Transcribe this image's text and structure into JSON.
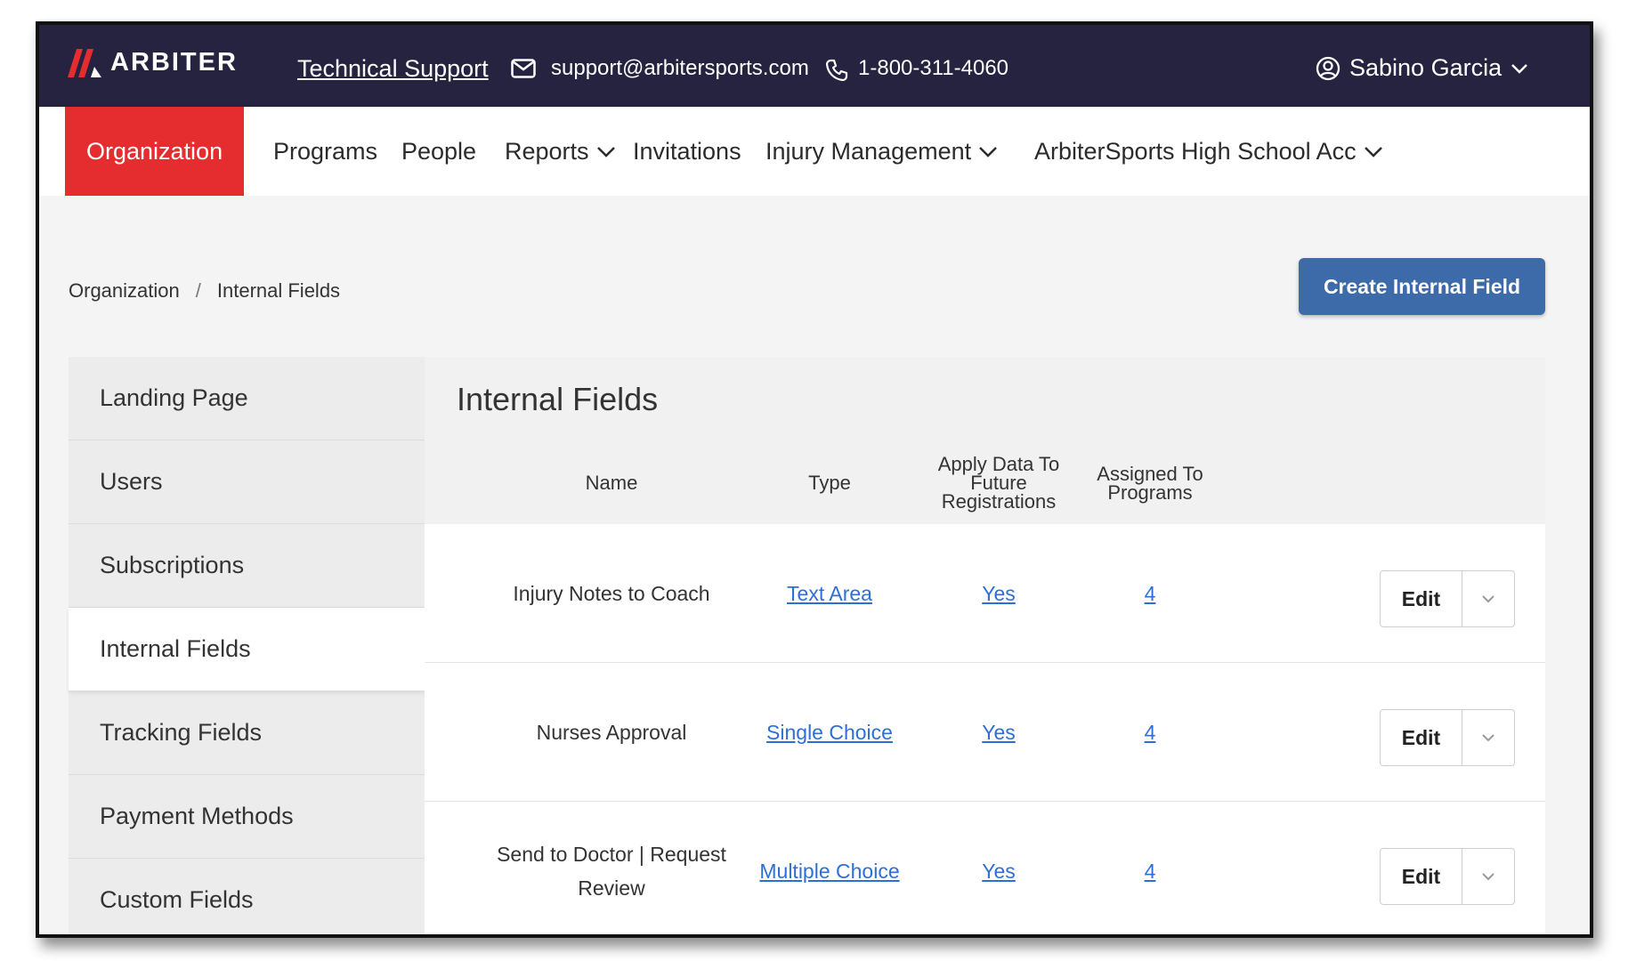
{
  "topbar": {
    "brand": "ARBITER",
    "support_link": "Technical Support",
    "email": "support@arbitersports.com",
    "phone": "1-800-311-4060",
    "user_name": "Sabino Garcia"
  },
  "nav": {
    "items": [
      {
        "label": "Organization",
        "active": true
      },
      {
        "label": "Programs"
      },
      {
        "label": "People"
      },
      {
        "label": "Reports",
        "has_dropdown": true
      },
      {
        "label": "Invitations"
      },
      {
        "label": "Injury Management",
        "has_dropdown": true
      },
      {
        "label": "ArbiterSports High School Acc",
        "has_dropdown": true
      }
    ]
  },
  "breadcrumb": {
    "items": [
      "Organization",
      "Internal Fields"
    ],
    "separator": "/"
  },
  "create_button": "Create Internal Field",
  "sidebar": {
    "items": [
      {
        "label": "Landing Page"
      },
      {
        "label": "Users"
      },
      {
        "label": "Subscriptions"
      },
      {
        "label": "Internal Fields",
        "active": true
      },
      {
        "label": "Tracking Fields"
      },
      {
        "label": "Payment Methods"
      },
      {
        "label": "Custom Fields"
      }
    ]
  },
  "panel": {
    "title": "Internal Fields",
    "columns": [
      "Name",
      "Type",
      "Apply Data To Future Registrations",
      "Assigned To Programs"
    ],
    "rows": [
      {
        "name": "Injury Notes to Coach",
        "type": "Text Area",
        "apply": "Yes",
        "assigned": "4",
        "edit": "Edit"
      },
      {
        "name": "Nurses Approval",
        "type": "Single Choice",
        "apply": "Yes",
        "assigned": "4",
        "edit": "Edit"
      },
      {
        "name": "Send to Doctor | Request Review",
        "type": "Multiple Choice",
        "apply": "Yes",
        "assigned": "4",
        "edit": "Edit"
      }
    ]
  },
  "colors": {
    "topbar_bg": "#25233f",
    "active_nav_bg": "#e52d2f",
    "primary_button": "#3d6aa8",
    "link": "#2e6fd6"
  }
}
